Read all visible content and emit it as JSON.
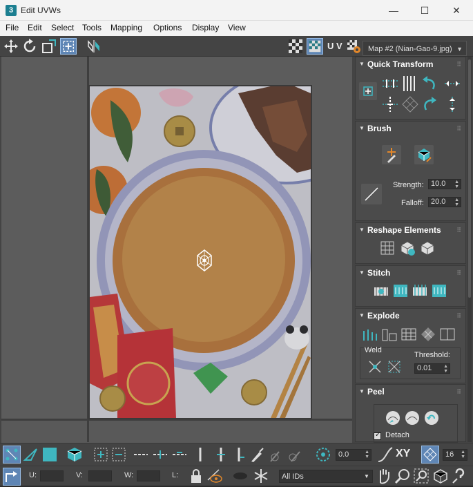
{
  "window": {
    "title": "Edit UVWs",
    "app_icon": "3",
    "minimize": "—",
    "maximize": "☐",
    "close": "✕"
  },
  "menu": [
    "File",
    "Edit",
    "Select",
    "Tools",
    "Mapping",
    "Options",
    "Display",
    "View"
  ],
  "toolbar": {
    "uv_label": "U V",
    "map_dropdown": "Map #2 (Nian-Gao-9.jpg)",
    "icons": [
      "move-icon",
      "rotate-icon",
      "scale-icon",
      "freeform-icon",
      "mirror-icon",
      "checker-icon",
      "checker-alt-icon",
      "uv-icon",
      "settings-icon"
    ]
  },
  "panels": {
    "quick_transform": {
      "title": "Quick Transform"
    },
    "brush": {
      "title": "Brush",
      "strength_label": "Strength:",
      "strength_value": "10.0",
      "falloff_label": "Falloff:",
      "falloff_value": "20.0"
    },
    "reshape": {
      "title": "Reshape Elements"
    },
    "stitch": {
      "title": "Stitch"
    },
    "explode": {
      "title": "Explode",
      "weld_label": "Weld",
      "threshold_label": "Threshold:",
      "threshold_value": "0.01"
    },
    "peel": {
      "title": "Peel",
      "detach_label": "Detach",
      "detach_checked": true
    }
  },
  "bottom_toolbar": {
    "angle_value": "0.0",
    "xy_label": "XY",
    "count_value": "16",
    "u_label": "U:",
    "v_label": "V:",
    "w_label": "W:",
    "l_label": "L:",
    "ids_dropdown": "All IDs"
  },
  "colors": {
    "accent": "#3fb7c0",
    "panel_bg": "#444444",
    "viewport_bg": "#5c5c5c"
  }
}
